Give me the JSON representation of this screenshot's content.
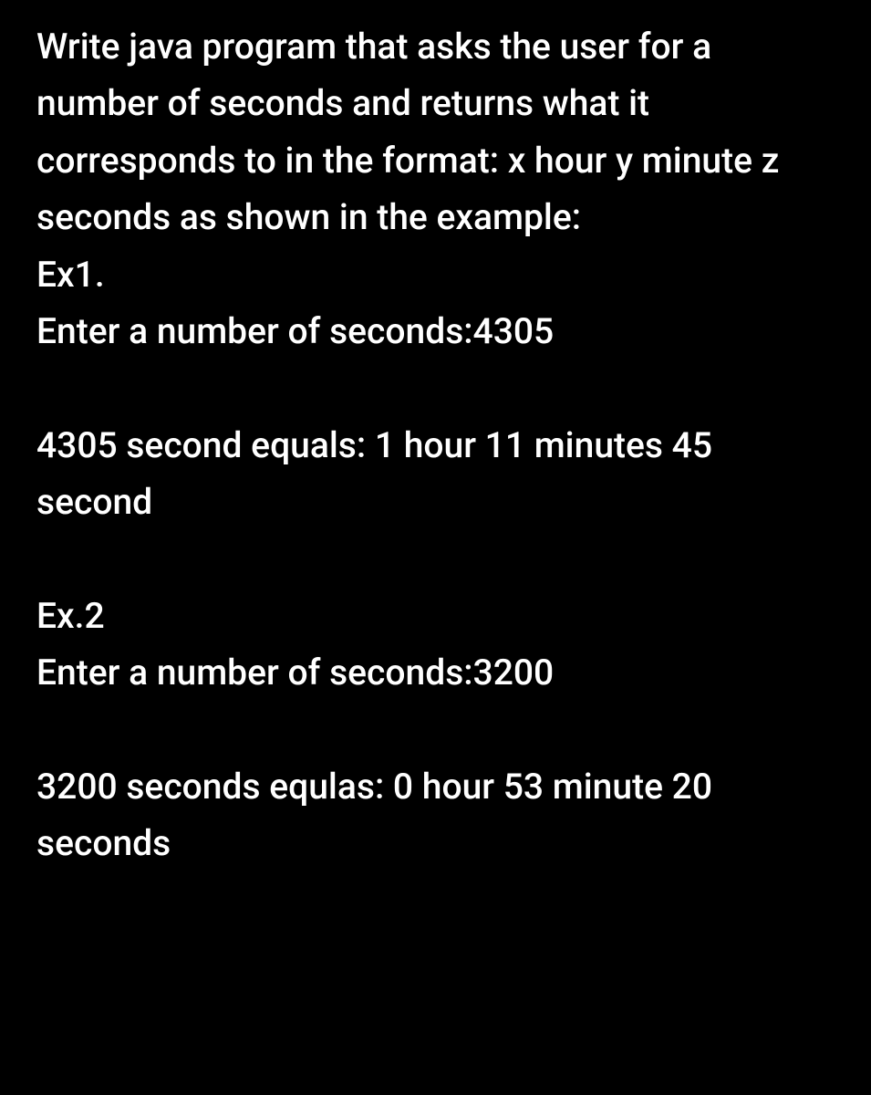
{
  "problem": {
    "statement": "Write java program that asks the user for a number of seconds and returns what it corresponds to in the format: x hour y minute z seconds as shown in the example:",
    "example1": {
      "label": "Ex1.",
      "prompt": "Enter a number of seconds:4305",
      "output": "4305 second equals: 1 hour 11 minutes 45 second"
    },
    "example2": {
      "label": "Ex.2",
      "prompt": "Enter a number of seconds:3200",
      "output": " 3200 seconds equlas: 0 hour 53 minute 20 seconds"
    }
  }
}
